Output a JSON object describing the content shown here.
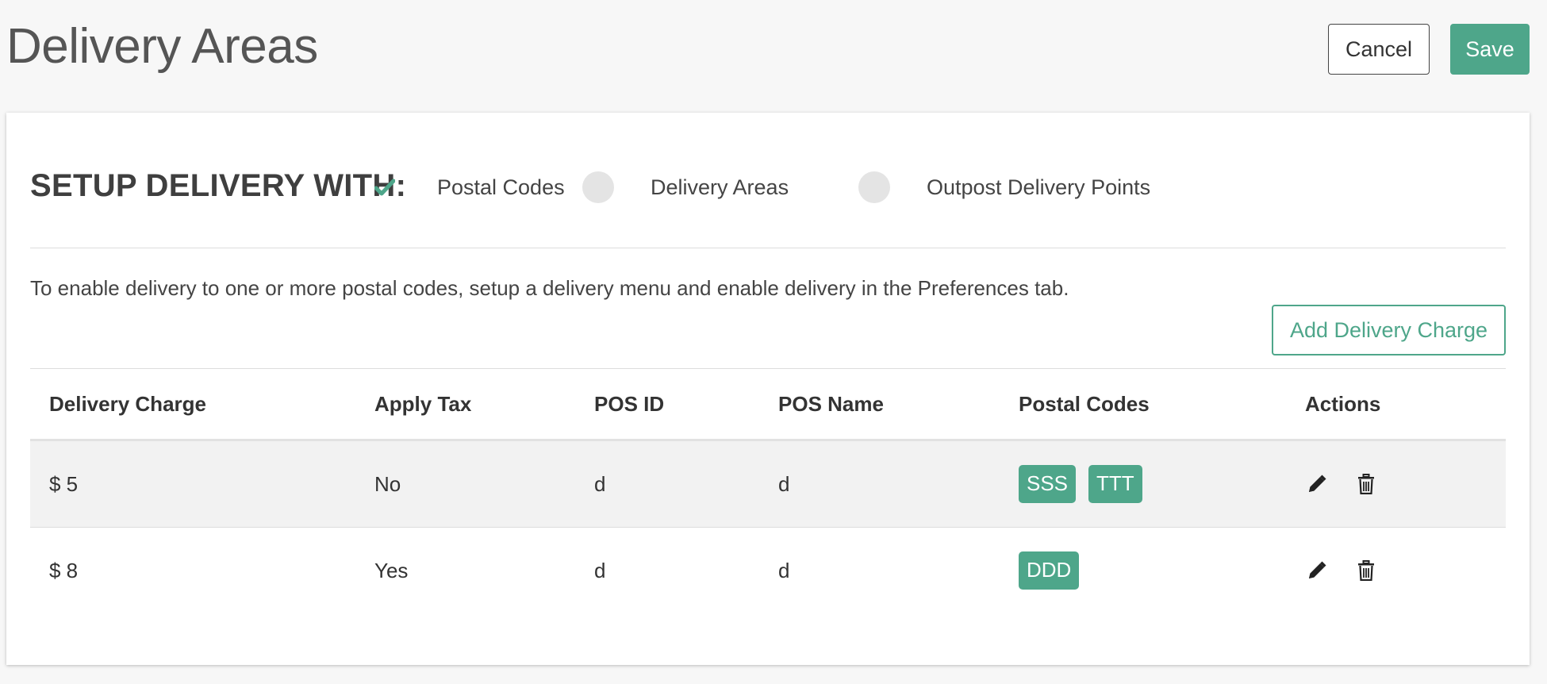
{
  "header": {
    "title": "Delivery Areas",
    "cancel_label": "Cancel",
    "save_label": "Save"
  },
  "colors": {
    "accent": "#4ea68a",
    "background": "#f7f7f7",
    "card": "#ffffff"
  },
  "setup": {
    "title": "SETUP DELIVERY WITH:",
    "options": [
      {
        "label": "Postal Codes",
        "selected": true,
        "icon": "check-icon"
      },
      {
        "label": "Delivery Areas",
        "selected": false,
        "icon": "radio-empty"
      },
      {
        "label": "Outpost Delivery Points",
        "selected": false,
        "icon": "radio-empty"
      }
    ]
  },
  "info_text": "To enable delivery to one or more postal codes, setup a delivery menu and enable delivery in the Preferences tab.",
  "add_charge_label": "Add Delivery Charge",
  "table": {
    "columns": [
      "Delivery Charge",
      "Apply Tax",
      "POS ID",
      "POS Name",
      "Postal Codes",
      "Actions"
    ],
    "rows": [
      {
        "charge": "$ 5",
        "apply_tax": "No",
        "pos_id": "d",
        "pos_name": "d",
        "postal_codes": [
          "SSS",
          "TTT"
        ]
      },
      {
        "charge": "$ 8",
        "apply_tax": "Yes",
        "pos_id": "d",
        "pos_name": "d",
        "postal_codes": [
          "DDD"
        ]
      }
    ],
    "action_icons": [
      "pencil-icon",
      "trash-icon"
    ]
  }
}
